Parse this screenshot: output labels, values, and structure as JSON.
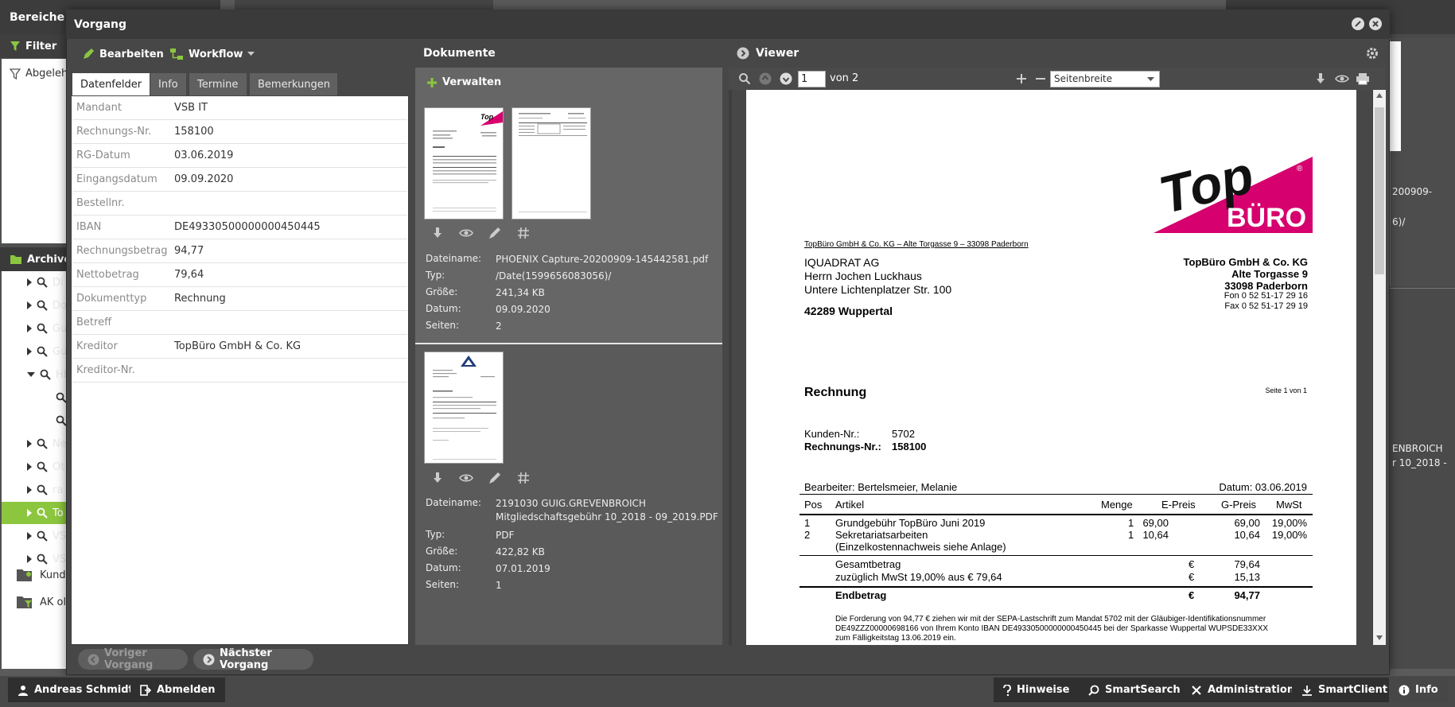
{
  "background": {
    "left_title": "Bereiche",
    "filter_label": "Filter",
    "filter_item": "Abgeleh",
    "archive_label": "Archive",
    "tree": [
      {
        "label": "Di",
        "expanded": false,
        "selected": false,
        "level": 0
      },
      {
        "label": "Do",
        "expanded": false,
        "selected": false,
        "level": 0
      },
      {
        "label": "Gu",
        "expanded": false,
        "selected": false,
        "level": 0
      },
      {
        "label": "Gu",
        "expanded": false,
        "selected": false,
        "level": 0
      },
      {
        "label": "HK",
        "expanded": true,
        "selected": false,
        "level": 0
      },
      {
        "label": "",
        "expanded": false,
        "selected": false,
        "level": 1
      },
      {
        "label": "",
        "expanded": false,
        "selected": false,
        "level": 1
      },
      {
        "label": "Ne",
        "expanded": false,
        "selected": false,
        "level": 0
      },
      {
        "label": "Ot",
        "expanded": false,
        "selected": false,
        "level": 0
      },
      {
        "label": "ra",
        "expanded": false,
        "selected": false,
        "level": 0
      },
      {
        "label": "To",
        "expanded": false,
        "selected": true,
        "level": 0
      },
      {
        "label": "VS",
        "expanded": false,
        "selected": false,
        "level": 0
      },
      {
        "label": "VS",
        "expanded": false,
        "selected": false,
        "level": 0
      }
    ],
    "kunden_label": "Kund",
    "ak_label": "AK ol",
    "right_texts": [
      "200909-",
      "6)/",
      "ENBROICH",
      "r 10_2018 -"
    ]
  },
  "dialog": {
    "title": "Vorgang",
    "toolbar": {
      "edit_label": "Bearbeiten",
      "workflow_label": "Workflow"
    },
    "tabs": [
      {
        "label": "Datenfelder",
        "active": true
      },
      {
        "label": "Info",
        "active": false
      },
      {
        "label": "Termine",
        "active": false
      },
      {
        "label": "Bemerkungen",
        "active": false
      }
    ],
    "fields": [
      {
        "label": "Mandant",
        "value": "VSB IT"
      },
      {
        "label": "Rechnungs-Nr.",
        "value": "158100"
      },
      {
        "label": "RG-Datum",
        "value": "03.06.2019"
      },
      {
        "label": "Eingangsdatum",
        "value": "09.09.2020"
      },
      {
        "label": "Bestellnr.",
        "value": ""
      },
      {
        "label": "IBAN",
        "value": "DE49330500000000450445"
      },
      {
        "label": "Rechnungsbetrag",
        "value": "94,77"
      },
      {
        "label": "Nettobetrag",
        "value": "79,64"
      },
      {
        "label": "Dokumenttyp",
        "value": "Rechnung"
      },
      {
        "label": "Betreff",
        "value": ""
      },
      {
        "label": "Kreditor",
        "value": "TopBüro GmbH & Co. KG"
      },
      {
        "label": "Kreditor-Nr.",
        "value": ""
      }
    ],
    "nav": {
      "prev_label": "Voriger Vorgang",
      "next_label": "Nächster Vorgang"
    }
  },
  "documents": {
    "title": "Dokumente",
    "manage_label": "Verwalten",
    "meta_labels": {
      "name": "Dateiname:",
      "type": "Typ:",
      "size": "Größe:",
      "date": "Datum:",
      "pages": "Seiten:"
    },
    "items": [
      {
        "name": "PHOENIX Capture-20200909-145442581.pdf",
        "type": "/Date(1599656083056)/",
        "size": "241,34 KB",
        "date": "09.09.2020",
        "pages": "2"
      },
      {
        "name": "2191030 GUIG.GREVENBROICH Mitgliedschaftsgebühr 10_2018 - 09_2019.PDF",
        "type": "PDF",
        "size": "422,82 KB",
        "date": "07.01.2019",
        "pages": "1"
      }
    ]
  },
  "viewer": {
    "title": "Viewer",
    "page_input": "1",
    "page_of": "von 2",
    "zoom": "Seitenbreite",
    "invoice": {
      "logo_top": "Top",
      "logo_buero": "BÜRO",
      "logo_reg": "®",
      "sender_line": "TopBüro GmbH & Co. KG – Alte Torgasse 9 – 33098 Paderborn",
      "recipient": [
        "IQUADRAT AG",
        "Herrn Jochen Luckhaus",
        "Untere Lichtenplatzer Str. 100"
      ],
      "recipient_city": "42289 Wuppertal",
      "sender_block": [
        "TopBüro GmbH & Co. KG",
        "Alte Torgasse 9",
        "33098 Paderborn"
      ],
      "sender_contact": [
        "Fon 0 52 51-17 29 16",
        "Fax 0 52 51-17 29 19"
      ],
      "heading": "Rechnung",
      "page_info": "Seite 1 von 1",
      "kunden_label": "Kunden-Nr.:",
      "kunden_value": "5702",
      "rechnung_label": "Rechnungs-Nr.:",
      "rechnung_value": "158100",
      "bearbeiter": "Bearbeiter: Bertelsmeier, Melanie",
      "datum": "Datum: 03.06.2019",
      "table_headers": [
        "Pos",
        "Artikel",
        "Menge",
        "E-Preis",
        "G-Preis",
        "MwSt"
      ],
      "rows": [
        {
          "pos": "1",
          "artikel": "Grundgebühr TopBüro Juni 2019",
          "menge": "1",
          "epreis": "69,00",
          "gpreis": "69,00",
          "mwst": "19,00%"
        },
        {
          "pos": "2",
          "artikel": "Sekretariatsarbeiten",
          "menge": "1",
          "epreis": "10,64",
          "gpreis": "10,64",
          "mwst": "19,00%"
        }
      ],
      "row_note": "(Einzelkostennachweis siehe Anlage)",
      "gesamt_label": "Gesamtbetrag",
      "gesamt_cur": "€",
      "gesamt_value": "79,64",
      "mwst_label": "zuzüglich MwSt 19,00% aus € 79,64",
      "mwst_cur": "€",
      "mwst_value": "15,13",
      "end_label": "Endbetrag",
      "end_cur": "€",
      "end_value": "94,77",
      "footer": [
        "Die Forderung von 94,77 € ziehen wir mit der SEPA-Lastschrift zum Mandat 5702 mit der Gläubiger-Identifikationsnummer",
        "DE49ZZZ00000698166 von Ihrem Konto IBAN DE49330500000000450445 bei der Sparkasse Wuppertal WUPSDE33XXX",
        "zum Fälligkeitstag 13.06.2019 ein."
      ]
    }
  },
  "bottombar": {
    "user": "Andreas Schmidt",
    "logout": "Abmelden",
    "hints": "Hinweise",
    "smartsearch": "SmartSearch",
    "admin": "Administration",
    "smartclient": "SmartClient",
    "info": "Info"
  },
  "colors": {
    "accent_green": "#8cc63f",
    "logo_magenta": "#d6006e"
  }
}
